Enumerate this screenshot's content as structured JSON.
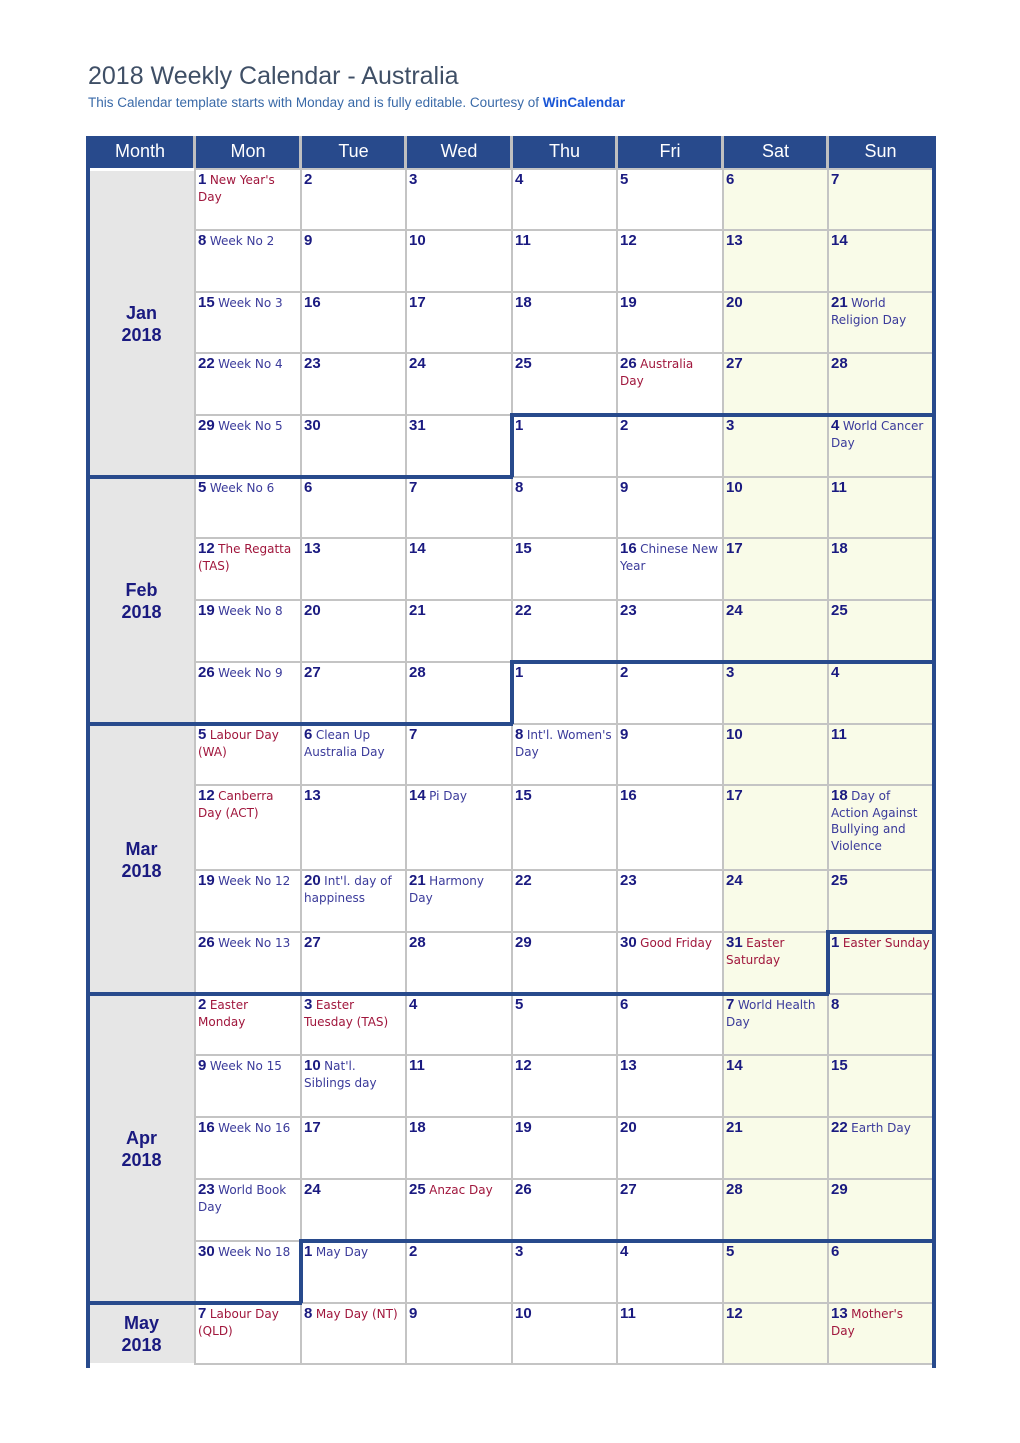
{
  "header": {
    "title": "2018 Weekly Calendar - Australia",
    "subtitle": "This Calendar template starts with Monday and is fully editable.  Courtesy of ",
    "brand_link": "WinCalendar"
  },
  "colors": {
    "header_bg": "#284a8c",
    "month_bg": "#e6e6e6",
    "weekend_bg": "#f9fbe8",
    "date_num": "#1a1a80",
    "holiday": "#a0163c",
    "observance": "#3a3a9a"
  },
  "columns": [
    "Month",
    "Mon",
    "Tue",
    "Wed",
    "Thu",
    "Fri",
    "Sat",
    "Sun"
  ],
  "months": [
    {
      "label": "Jan",
      "year": "2018"
    },
    {
      "label": "Feb",
      "year": "2018"
    },
    {
      "label": "Mar",
      "year": "2018"
    },
    {
      "label": "Apr",
      "year": "2018"
    },
    {
      "label": "May",
      "year": "2018"
    }
  ],
  "weeks": [
    {
      "days": [
        {
          "n": "1",
          "e": "New Year's Day",
          "t": "hol"
        },
        {
          "n": "2"
        },
        {
          "n": "3"
        },
        {
          "n": "4"
        },
        {
          "n": "5"
        },
        {
          "n": "6"
        },
        {
          "n": "7"
        }
      ]
    },
    {
      "days": [
        {
          "n": "8",
          "e": "Week No 2",
          "t": "obs"
        },
        {
          "n": "9"
        },
        {
          "n": "10"
        },
        {
          "n": "11"
        },
        {
          "n": "12"
        },
        {
          "n": "13"
        },
        {
          "n": "14"
        }
      ]
    },
    {
      "days": [
        {
          "n": "15",
          "e": "Week No 3",
          "t": "obs"
        },
        {
          "n": "16"
        },
        {
          "n": "17"
        },
        {
          "n": "18"
        },
        {
          "n": "19"
        },
        {
          "n": "20"
        },
        {
          "n": "21",
          "e": "World Religion Day",
          "t": "obs"
        }
      ]
    },
    {
      "days": [
        {
          "n": "22",
          "e": "Week No 4",
          "t": "obs"
        },
        {
          "n": "23"
        },
        {
          "n": "24"
        },
        {
          "n": "25"
        },
        {
          "n": "26",
          "e": "Australia Day",
          "t": "hol"
        },
        {
          "n": "27"
        },
        {
          "n": "28"
        }
      ]
    },
    {
      "days": [
        {
          "n": "29",
          "e": "Week No 5",
          "t": "obs"
        },
        {
          "n": "30"
        },
        {
          "n": "31"
        },
        {
          "n": "1"
        },
        {
          "n": "2"
        },
        {
          "n": "3"
        },
        {
          "n": "4",
          "e": "World Cancer Day",
          "t": "obs"
        }
      ]
    },
    {
      "days": [
        {
          "n": "5",
          "e": "Week No 6",
          "t": "obs"
        },
        {
          "n": "6"
        },
        {
          "n": "7"
        },
        {
          "n": "8"
        },
        {
          "n": "9"
        },
        {
          "n": "10"
        },
        {
          "n": "11"
        }
      ]
    },
    {
      "days": [
        {
          "n": "12",
          "e": "The Regatta (TAS)",
          "t": "hol"
        },
        {
          "n": "13"
        },
        {
          "n": "14"
        },
        {
          "n": "15"
        },
        {
          "n": "16",
          "e": "Chinese New Year",
          "t": "obs"
        },
        {
          "n": "17"
        },
        {
          "n": "18"
        }
      ]
    },
    {
      "days": [
        {
          "n": "19",
          "e": "Week No 8",
          "t": "obs"
        },
        {
          "n": "20"
        },
        {
          "n": "21"
        },
        {
          "n": "22"
        },
        {
          "n": "23"
        },
        {
          "n": "24"
        },
        {
          "n": "25"
        }
      ]
    },
    {
      "days": [
        {
          "n": "26",
          "e": "Week No 9",
          "t": "obs"
        },
        {
          "n": "27"
        },
        {
          "n": "28"
        },
        {
          "n": "1"
        },
        {
          "n": "2"
        },
        {
          "n": "3"
        },
        {
          "n": "4"
        }
      ]
    },
    {
      "days": [
        {
          "n": "5",
          "e": "Labour Day (WA)",
          "t": "hol"
        },
        {
          "n": "6",
          "e": "Clean Up Australia Day",
          "t": "obs"
        },
        {
          "n": "7"
        },
        {
          "n": "8",
          "e": "Int'l. Women's Day",
          "t": "obs"
        },
        {
          "n": "9"
        },
        {
          "n": "10"
        },
        {
          "n": "11"
        }
      ]
    },
    {
      "days": [
        {
          "n": "12",
          "e": "Canberra Day (ACT)",
          "t": "hol"
        },
        {
          "n": "13"
        },
        {
          "n": "14",
          "e": "Pi Day",
          "t": "obs"
        },
        {
          "n": "15"
        },
        {
          "n": "16"
        },
        {
          "n": "17"
        },
        {
          "n": "18",
          "e": "Day of Action Against Bullying and Violence",
          "t": "obs"
        }
      ]
    },
    {
      "days": [
        {
          "n": "19",
          "e": "Week No 12",
          "t": "obs"
        },
        {
          "n": "20",
          "e": "Int'l. day of happiness",
          "t": "obs"
        },
        {
          "n": "21",
          "e": "Harmony Day",
          "t": "obs"
        },
        {
          "n": "22"
        },
        {
          "n": "23"
        },
        {
          "n": "24"
        },
        {
          "n": "25"
        }
      ]
    },
    {
      "days": [
        {
          "n": "26",
          "e": "Week No 13",
          "t": "obs"
        },
        {
          "n": "27"
        },
        {
          "n": "28"
        },
        {
          "n": "29"
        },
        {
          "n": "30",
          "e": "Good Friday",
          "t": "hol"
        },
        {
          "n": "31",
          "e": "Easter Saturday",
          "t": "hol"
        },
        {
          "n": "1",
          "e": "Easter Sunday",
          "t": "hol"
        }
      ]
    },
    {
      "days": [
        {
          "n": "2",
          "e": "Easter Monday",
          "t": "hol"
        },
        {
          "n": "3",
          "e": "Easter Tuesday (TAS)",
          "t": "hol"
        },
        {
          "n": "4"
        },
        {
          "n": "5"
        },
        {
          "n": "6"
        },
        {
          "n": "7",
          "e": "World Health Day",
          "t": "obs"
        },
        {
          "n": "8"
        }
      ]
    },
    {
      "days": [
        {
          "n": "9",
          "e": "Week No 15",
          "t": "obs"
        },
        {
          "n": "10",
          "e": "Nat'l. Siblings day",
          "t": "obs"
        },
        {
          "n": "11"
        },
        {
          "n": "12"
        },
        {
          "n": "13"
        },
        {
          "n": "14"
        },
        {
          "n": "15"
        }
      ]
    },
    {
      "days": [
        {
          "n": "16",
          "e": "Week No 16",
          "t": "obs"
        },
        {
          "n": "17"
        },
        {
          "n": "18"
        },
        {
          "n": "19"
        },
        {
          "n": "20"
        },
        {
          "n": "21"
        },
        {
          "n": "22",
          "e": "Earth Day",
          "t": "obs"
        }
      ]
    },
    {
      "days": [
        {
          "n": "23",
          "e": "World Book Day",
          "t": "obs"
        },
        {
          "n": "24"
        },
        {
          "n": "25",
          "e": "Anzac Day",
          "t": "hol"
        },
        {
          "n": "26"
        },
        {
          "n": "27"
        },
        {
          "n": "28"
        },
        {
          "n": "29"
        }
      ]
    },
    {
      "days": [
        {
          "n": "30",
          "e": "Week No 18",
          "t": "obs"
        },
        {
          "n": "1",
          "e": "May Day",
          "t": "obs"
        },
        {
          "n": "2"
        },
        {
          "n": "3"
        },
        {
          "n": "4"
        },
        {
          "n": "5"
        },
        {
          "n": "6"
        }
      ]
    },
    {
      "days": [
        {
          "n": "7",
          "e": "Labour Day (QLD)",
          "t": "hol"
        },
        {
          "n": "8",
          "e": "May Day (NT)",
          "t": "hol"
        },
        {
          "n": "9"
        },
        {
          "n": "10"
        },
        {
          "n": "11"
        },
        {
          "n": "12"
        },
        {
          "n": "13",
          "e": "Mother's Day",
          "t": "hol"
        }
      ]
    }
  ]
}
